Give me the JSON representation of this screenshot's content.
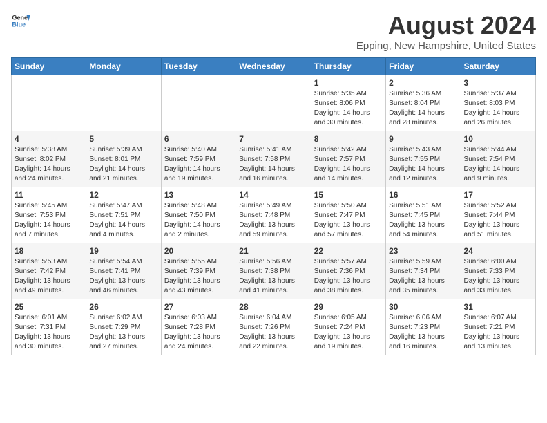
{
  "header": {
    "logo_general": "General",
    "logo_blue": "Blue",
    "title": "August 2024",
    "subtitle": "Epping, New Hampshire, United States"
  },
  "days_of_week": [
    "Sunday",
    "Monday",
    "Tuesday",
    "Wednesday",
    "Thursday",
    "Friday",
    "Saturday"
  ],
  "weeks": [
    [
      {
        "day": "",
        "info": ""
      },
      {
        "day": "",
        "info": ""
      },
      {
        "day": "",
        "info": ""
      },
      {
        "day": "",
        "info": ""
      },
      {
        "day": "1",
        "info": "Sunrise: 5:35 AM\nSunset: 8:06 PM\nDaylight: 14 hours and 30 minutes."
      },
      {
        "day": "2",
        "info": "Sunrise: 5:36 AM\nSunset: 8:04 PM\nDaylight: 14 hours and 28 minutes."
      },
      {
        "day": "3",
        "info": "Sunrise: 5:37 AM\nSunset: 8:03 PM\nDaylight: 14 hours and 26 minutes."
      }
    ],
    [
      {
        "day": "4",
        "info": "Sunrise: 5:38 AM\nSunset: 8:02 PM\nDaylight: 14 hours and 24 minutes."
      },
      {
        "day": "5",
        "info": "Sunrise: 5:39 AM\nSunset: 8:01 PM\nDaylight: 14 hours and 21 minutes."
      },
      {
        "day": "6",
        "info": "Sunrise: 5:40 AM\nSunset: 7:59 PM\nDaylight: 14 hours and 19 minutes."
      },
      {
        "day": "7",
        "info": "Sunrise: 5:41 AM\nSunset: 7:58 PM\nDaylight: 14 hours and 16 minutes."
      },
      {
        "day": "8",
        "info": "Sunrise: 5:42 AM\nSunset: 7:57 PM\nDaylight: 14 hours and 14 minutes."
      },
      {
        "day": "9",
        "info": "Sunrise: 5:43 AM\nSunset: 7:55 PM\nDaylight: 14 hours and 12 minutes."
      },
      {
        "day": "10",
        "info": "Sunrise: 5:44 AM\nSunset: 7:54 PM\nDaylight: 14 hours and 9 minutes."
      }
    ],
    [
      {
        "day": "11",
        "info": "Sunrise: 5:45 AM\nSunset: 7:53 PM\nDaylight: 14 hours and 7 minutes."
      },
      {
        "day": "12",
        "info": "Sunrise: 5:47 AM\nSunset: 7:51 PM\nDaylight: 14 hours and 4 minutes."
      },
      {
        "day": "13",
        "info": "Sunrise: 5:48 AM\nSunset: 7:50 PM\nDaylight: 14 hours and 2 minutes."
      },
      {
        "day": "14",
        "info": "Sunrise: 5:49 AM\nSunset: 7:48 PM\nDaylight: 13 hours and 59 minutes."
      },
      {
        "day": "15",
        "info": "Sunrise: 5:50 AM\nSunset: 7:47 PM\nDaylight: 13 hours and 57 minutes."
      },
      {
        "day": "16",
        "info": "Sunrise: 5:51 AM\nSunset: 7:45 PM\nDaylight: 13 hours and 54 minutes."
      },
      {
        "day": "17",
        "info": "Sunrise: 5:52 AM\nSunset: 7:44 PM\nDaylight: 13 hours and 51 minutes."
      }
    ],
    [
      {
        "day": "18",
        "info": "Sunrise: 5:53 AM\nSunset: 7:42 PM\nDaylight: 13 hours and 49 minutes."
      },
      {
        "day": "19",
        "info": "Sunrise: 5:54 AM\nSunset: 7:41 PM\nDaylight: 13 hours and 46 minutes."
      },
      {
        "day": "20",
        "info": "Sunrise: 5:55 AM\nSunset: 7:39 PM\nDaylight: 13 hours and 43 minutes."
      },
      {
        "day": "21",
        "info": "Sunrise: 5:56 AM\nSunset: 7:38 PM\nDaylight: 13 hours and 41 minutes."
      },
      {
        "day": "22",
        "info": "Sunrise: 5:57 AM\nSunset: 7:36 PM\nDaylight: 13 hours and 38 minutes."
      },
      {
        "day": "23",
        "info": "Sunrise: 5:59 AM\nSunset: 7:34 PM\nDaylight: 13 hours and 35 minutes."
      },
      {
        "day": "24",
        "info": "Sunrise: 6:00 AM\nSunset: 7:33 PM\nDaylight: 13 hours and 33 minutes."
      }
    ],
    [
      {
        "day": "25",
        "info": "Sunrise: 6:01 AM\nSunset: 7:31 PM\nDaylight: 13 hours and 30 minutes."
      },
      {
        "day": "26",
        "info": "Sunrise: 6:02 AM\nSunset: 7:29 PM\nDaylight: 13 hours and 27 minutes."
      },
      {
        "day": "27",
        "info": "Sunrise: 6:03 AM\nSunset: 7:28 PM\nDaylight: 13 hours and 24 minutes."
      },
      {
        "day": "28",
        "info": "Sunrise: 6:04 AM\nSunset: 7:26 PM\nDaylight: 13 hours and 22 minutes."
      },
      {
        "day": "29",
        "info": "Sunrise: 6:05 AM\nSunset: 7:24 PM\nDaylight: 13 hours and 19 minutes."
      },
      {
        "day": "30",
        "info": "Sunrise: 6:06 AM\nSunset: 7:23 PM\nDaylight: 13 hours and 16 minutes."
      },
      {
        "day": "31",
        "info": "Sunrise: 6:07 AM\nSunset: 7:21 PM\nDaylight: 13 hours and 13 minutes."
      }
    ]
  ]
}
